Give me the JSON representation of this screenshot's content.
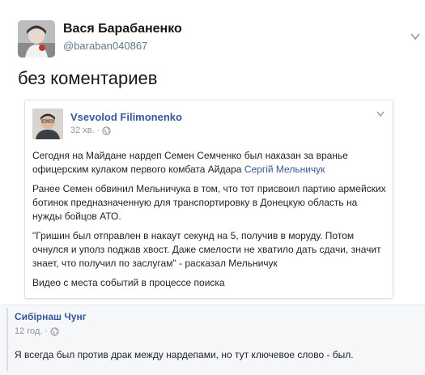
{
  "tweet": {
    "author_name": "Вася Барабаненко",
    "author_handle": "@baraban040867",
    "text": "без коментариев"
  },
  "embedded_post": {
    "author_name": "Vsevolod Filimonenko",
    "time": "32 хв.",
    "separator": "·",
    "paragraphs": [
      {
        "text": "Сегодня на Майдане нардеп Семен Семченко был наказан за вранье офицерским кулаком первого комбата Айдара ",
        "link": "Сергій Мельничук"
      },
      {
        "text": "Ранее Семен обвинил Мельничука в том, что тот присвоил партию армейских ботинок предназначенную для транспортировку в Донецкую область на нужды бойцов АТО."
      },
      {
        "text": "\"Гришин был отправлен в накаут секунд на 5, получив в моруду. Потом очнулся и уполз поджав хвост. Даже смелости не хватило дать сдачи, значит знает, что получил по заслугам\" - расказал Мельничук"
      },
      {
        "text": "Видео с места событий в процессе поиска"
      }
    ]
  },
  "comment": {
    "author_name": "Сибірнаш Чунг",
    "time": "12 год.",
    "separator": "·",
    "text": "Я всегда был против драк между нардепами, но тут ключевое слово - был."
  },
  "icons": {
    "tweet_menu": "chevron-down-icon",
    "post_menu": "chevron-down-icon",
    "privacy": "globe-icon"
  },
  "colors": {
    "link_blue": "#365899",
    "meta_gray": "#90949c",
    "handle_gray": "#657786"
  }
}
